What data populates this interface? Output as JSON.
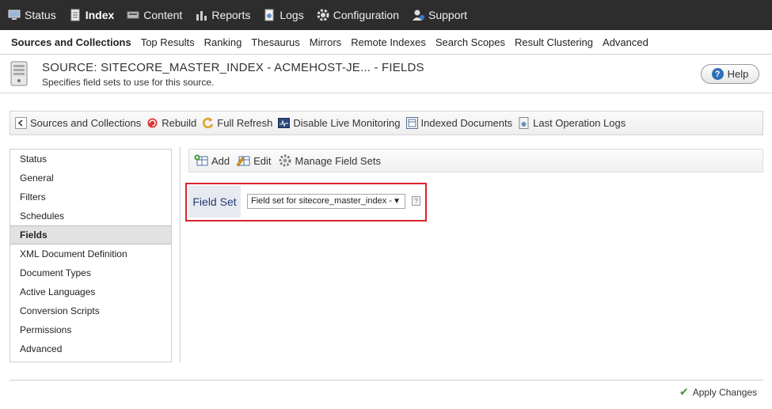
{
  "topnav": [
    {
      "label": "Status",
      "icon": "monitor-icon"
    },
    {
      "label": "Index",
      "icon": "index-icon",
      "active": true
    },
    {
      "label": "Content",
      "icon": "content-icon"
    },
    {
      "label": "Reports",
      "icon": "bar-chart-icon"
    },
    {
      "label": "Logs",
      "icon": "logs-icon"
    },
    {
      "label": "Configuration",
      "icon": "gear-icon"
    },
    {
      "label": "Support",
      "icon": "support-icon"
    }
  ],
  "subnav": [
    "Sources and Collections",
    "Top Results",
    "Ranking",
    "Thesaurus",
    "Mirrors",
    "Remote Indexes",
    "Search Scopes",
    "Result Clustering",
    "Advanced"
  ],
  "header": {
    "title": "SOURCE: SITECORE_MASTER_INDEX - ACMEHOST-JE... - FIELDS",
    "subtitle": "Specifies field sets to use for this source.",
    "help_label": "Help"
  },
  "actions": [
    {
      "label": "Sources and Collections",
      "icon": "back-icon"
    },
    {
      "label": "Rebuild",
      "icon": "rebuild-icon"
    },
    {
      "label": "Full Refresh",
      "icon": "refresh-icon"
    },
    {
      "label": "Disable Live Monitoring",
      "icon": "monitoring-icon"
    },
    {
      "label": "Indexed Documents",
      "icon": "documents-icon"
    },
    {
      "label": "Last Operation Logs",
      "icon": "logs-icon"
    }
  ],
  "leftmenu": [
    "Status",
    "General",
    "Filters",
    "Schedules",
    "Fields",
    "XML Document Definition",
    "Document Types",
    "Active Languages",
    "Conversion Scripts",
    "Permissions",
    "Advanced"
  ],
  "leftmenu_active": "Fields",
  "toolbar": {
    "add": "Add",
    "edit": "Edit",
    "manage": "Manage Field Sets"
  },
  "fieldset": {
    "label": "Field Set",
    "selected": "Field set for sitecore_master_index -",
    "help": "?"
  },
  "apply_label": "Apply Changes",
  "colors": {
    "nav_bg": "#2d2d2d",
    "highlight_border": "#d9232f",
    "accent": "#2f6fb8"
  }
}
